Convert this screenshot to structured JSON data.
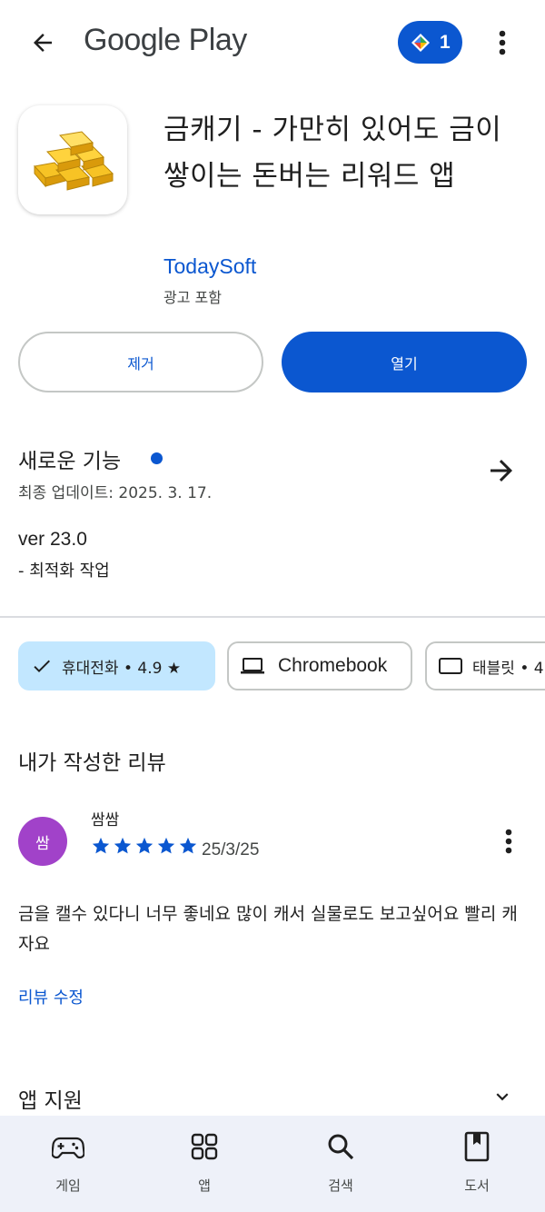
{
  "header": {
    "brand": "Google Play",
    "rewards_count": "1"
  },
  "app": {
    "title": "금캐기 - 가만히 있어도 금이 쌓이는 돈버는 리워드 앱",
    "developer": "TodaySoft",
    "ads_note": "광고 포함",
    "remove_label": "제거",
    "open_label": "열기"
  },
  "whats_new": {
    "title": "새로운 기능",
    "updated": "최종 업데이트: 2025. 3. 17.",
    "version": "ver 23.0",
    "changes": "- 최적화 작업"
  },
  "devices": {
    "phone_label": "휴대전화 • 4.9 ★",
    "chromebook_label": "Chromebook",
    "tablet_label": "태블릿 • 4"
  },
  "my_review": {
    "heading": "내가 작성한 리뷰",
    "avatar_initial": "쌈",
    "reviewer": "쌈쌈",
    "rating": 5,
    "date": "25/3/25",
    "text": "금을 캘수 있다니 너무 좋네요 많이 캐서 실물로도 보고싶어요 빨리 캐자요",
    "edit_label": "리뷰 수정"
  },
  "support": {
    "title": "앱 지원"
  },
  "bottom_nav": [
    {
      "label": "게임",
      "icon": "gamepad-icon"
    },
    {
      "label": "앱",
      "icon": "apps-grid-icon"
    },
    {
      "label": "검색",
      "icon": "search-icon"
    },
    {
      "label": "도서",
      "icon": "book-icon"
    }
  ],
  "colors": {
    "accent": "#0b57d0",
    "chip_selected": "#c2e7ff",
    "avatar": "#a142c9",
    "nav_bg": "#eef1f9"
  }
}
